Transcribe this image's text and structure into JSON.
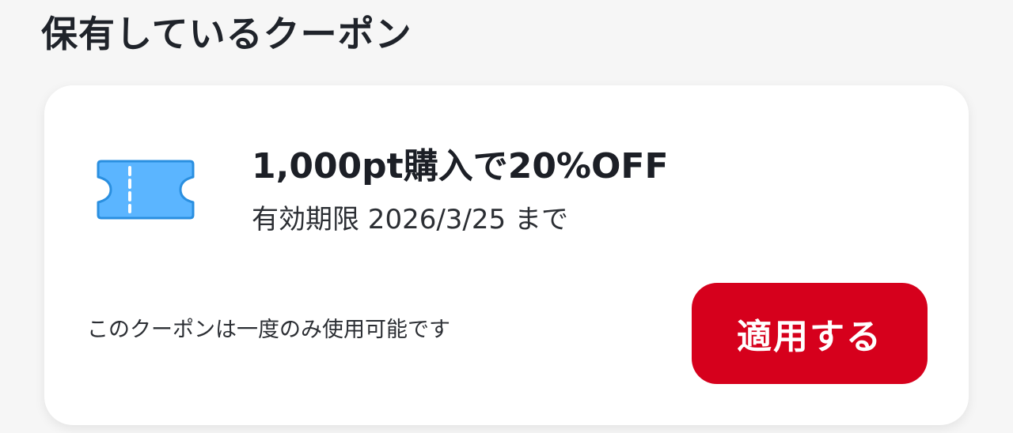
{
  "section": {
    "title": "保有しているクーポン"
  },
  "coupon": {
    "icon": "ticket-icon",
    "title": "1,000pt購入で20%OFF",
    "expiry": "有効期限 2026/3/25 まで",
    "note": "このクーポンは一度のみ使用可能です",
    "apply_label": "適用する"
  },
  "colors": {
    "accent": "#d6001c",
    "ticket_fill": "#5bb5ff",
    "ticket_stroke": "#2a8fe0"
  }
}
